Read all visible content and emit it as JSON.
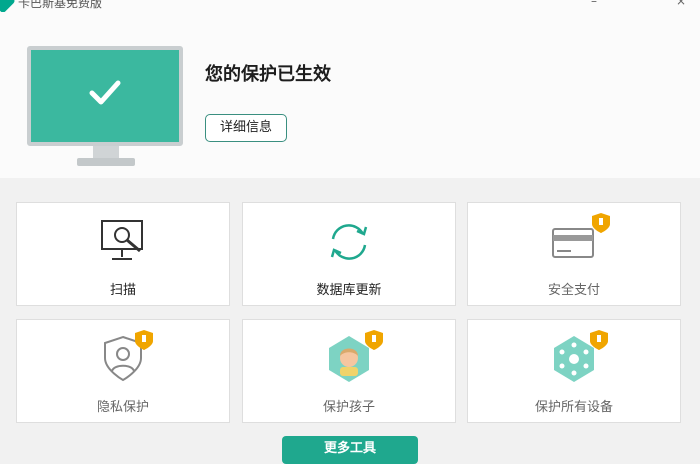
{
  "window": {
    "title": "卡巴斯基免费版",
    "minimize_glyph": "–",
    "close_glyph": "×"
  },
  "status": {
    "title": "您的保护已生效",
    "details_button": "详细信息"
  },
  "tools": [
    {
      "label": "扫描",
      "icon": "scan-monitor-icon",
      "locked": false
    },
    {
      "label": "数据库更新",
      "icon": "update-arrows-icon",
      "locked": false
    },
    {
      "label": "安全支付",
      "icon": "credit-card-icon",
      "locked": true
    },
    {
      "label": "隐私保护",
      "icon": "privacy-shield-icon",
      "locked": true
    },
    {
      "label": "保护孩子",
      "icon": "child-icon",
      "locked": true
    },
    {
      "label": "保护所有设备",
      "icon": "devices-icon",
      "locked": true
    }
  ],
  "more_tools_button": "更多工具",
  "colors": {
    "accent": "#1fa88e",
    "screen": "#3bb89f",
    "badge": "#f0a500"
  }
}
